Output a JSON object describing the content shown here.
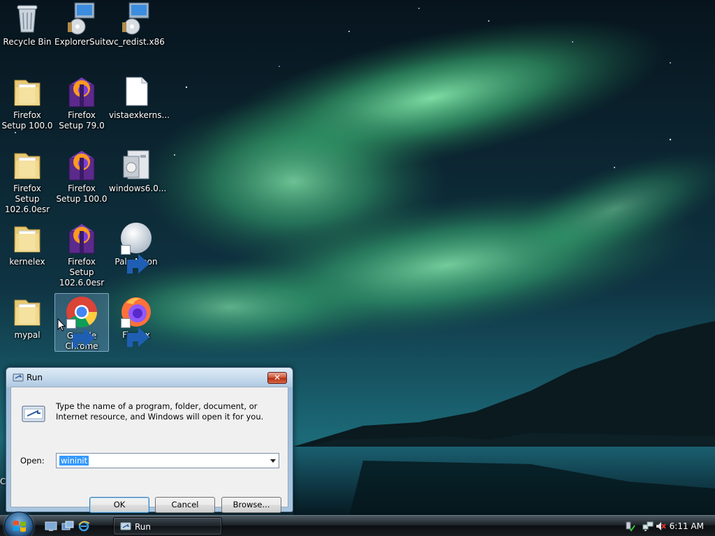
{
  "desktop": {
    "icons": [
      {
        "label": "Recycle Bin",
        "icon": "recycle-bin-icon"
      },
      {
        "label": "ExplorerSuite",
        "icon": "installer-icon"
      },
      {
        "label": "vc_redist.x86",
        "icon": "installer-icon"
      },
      {
        "label": "Firefox Setup 100.0",
        "icon": "folder-icon"
      },
      {
        "label": "Firefox Setup 79.0",
        "icon": "firefox-setup-icon"
      },
      {
        "label": "vistaexkerns...",
        "icon": "file-icon"
      },
      {
        "label": "Firefox Setup 102.6.0esr",
        "icon": "folder-icon"
      },
      {
        "label": "Firefox Setup 100.0",
        "icon": "firefox-setup-icon"
      },
      {
        "label": "windows6.0...",
        "icon": "update-package-icon"
      },
      {
        "label": "kernelex",
        "icon": "folder-icon"
      },
      {
        "label": "Firefox Setup 102.6.0esr",
        "icon": "firefox-setup-icon"
      },
      {
        "label": "Pale Moon",
        "icon": "pale-moon-icon"
      },
      {
        "label": "mypal",
        "icon": "folder-icon"
      },
      {
        "label": "Google Chrome",
        "icon": "chrome-icon"
      },
      {
        "label": "Firefox",
        "icon": "firefox-icon"
      }
    ],
    "selected_icon": "Google Chrome",
    "edge_letter": "C"
  },
  "run_dialog": {
    "title": "Run",
    "close_label": "✕",
    "description": "Type the name of a program, folder, document, or Internet resource, and Windows will open it for you.",
    "open_label": "Open:",
    "open_value": "wininit",
    "ok_label": "OK",
    "cancel_label": "Cancel",
    "browse_label": "Browse..."
  },
  "taskbar": {
    "active_task": "Run",
    "clock": "6:11 AM",
    "quick_launch": [
      "show-desktop-icon",
      "switch-windows-icon",
      "internet-explorer-icon"
    ],
    "tray": [
      "safely-remove-icon",
      "network-icon",
      "volume-muted-icon"
    ]
  },
  "colors": {
    "aurora": "#4fd08a",
    "selection": "#3399ff",
    "dialog_frame": "#a9c6e0"
  }
}
